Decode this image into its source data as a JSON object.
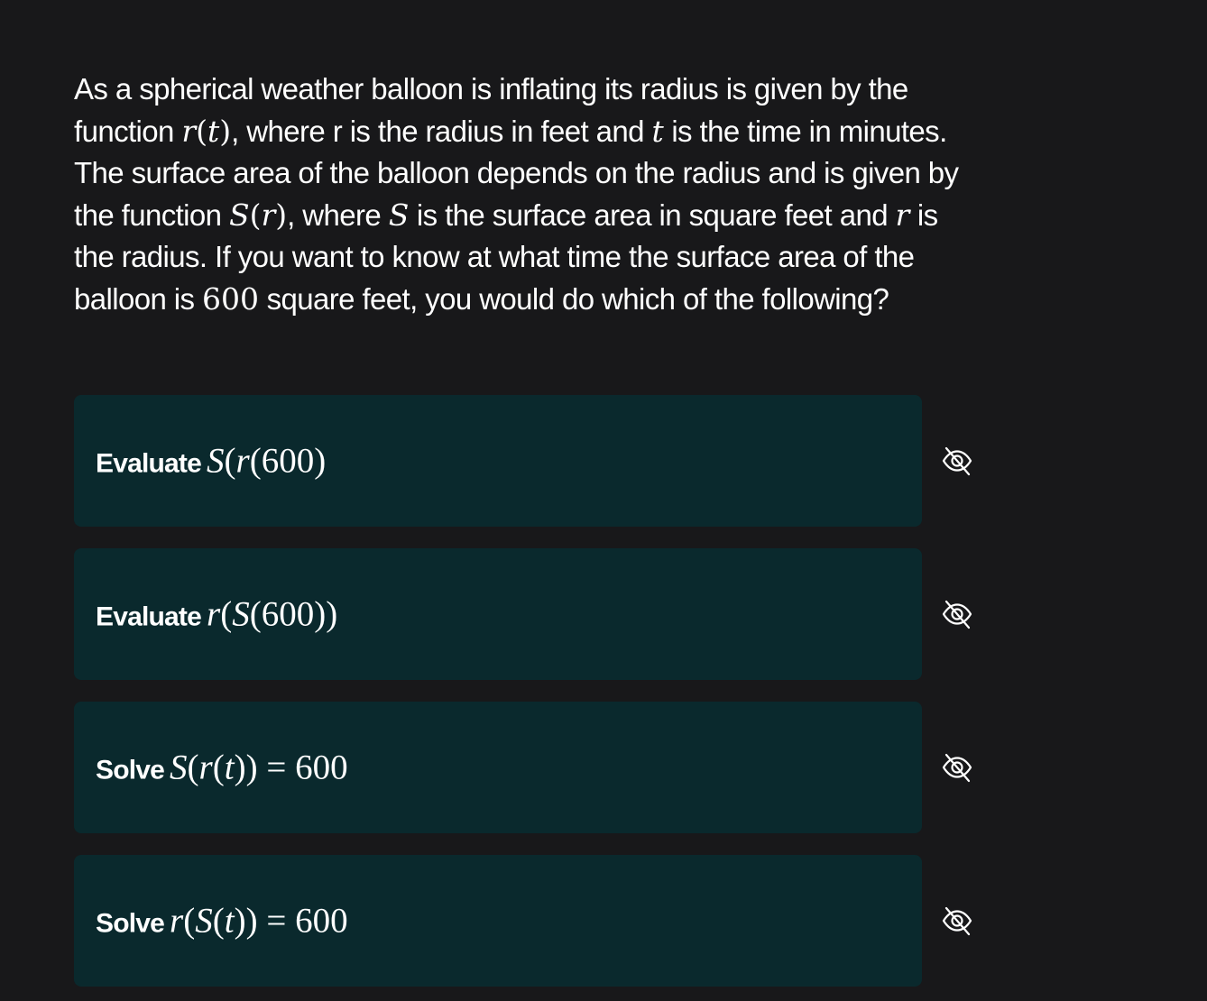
{
  "question": {
    "p1": "As a spherical weather balloon is inflating its radius is given by the function ",
    "m1": "r(t)",
    "p2": ", where r is the radius in feet and ",
    "m2": "t",
    "p3": " is the time in minutes. The surface area of the balloon depends on the radius and is given by the function ",
    "m3": "S(r)",
    "p4": ", where ",
    "m4": "S",
    "p5": " is the surface area in square feet and ",
    "m5": "r",
    "p6": " is the radius. If you want to know at what time the surface area of the balloon is ",
    "m6": "600",
    "p7": " square feet, you would do which of the following?"
  },
  "options": [
    {
      "verb": "Evaluate",
      "expr": "S(r(600)"
    },
    {
      "verb": "Evaluate",
      "expr": "r(S(600))"
    },
    {
      "verb": "Solve",
      "expr": "S(r(t)) = 600"
    },
    {
      "verb": "Solve",
      "expr": "r(S(t)) = 600"
    }
  ],
  "icons": {
    "option_toggle": "eye-slash-icon"
  }
}
